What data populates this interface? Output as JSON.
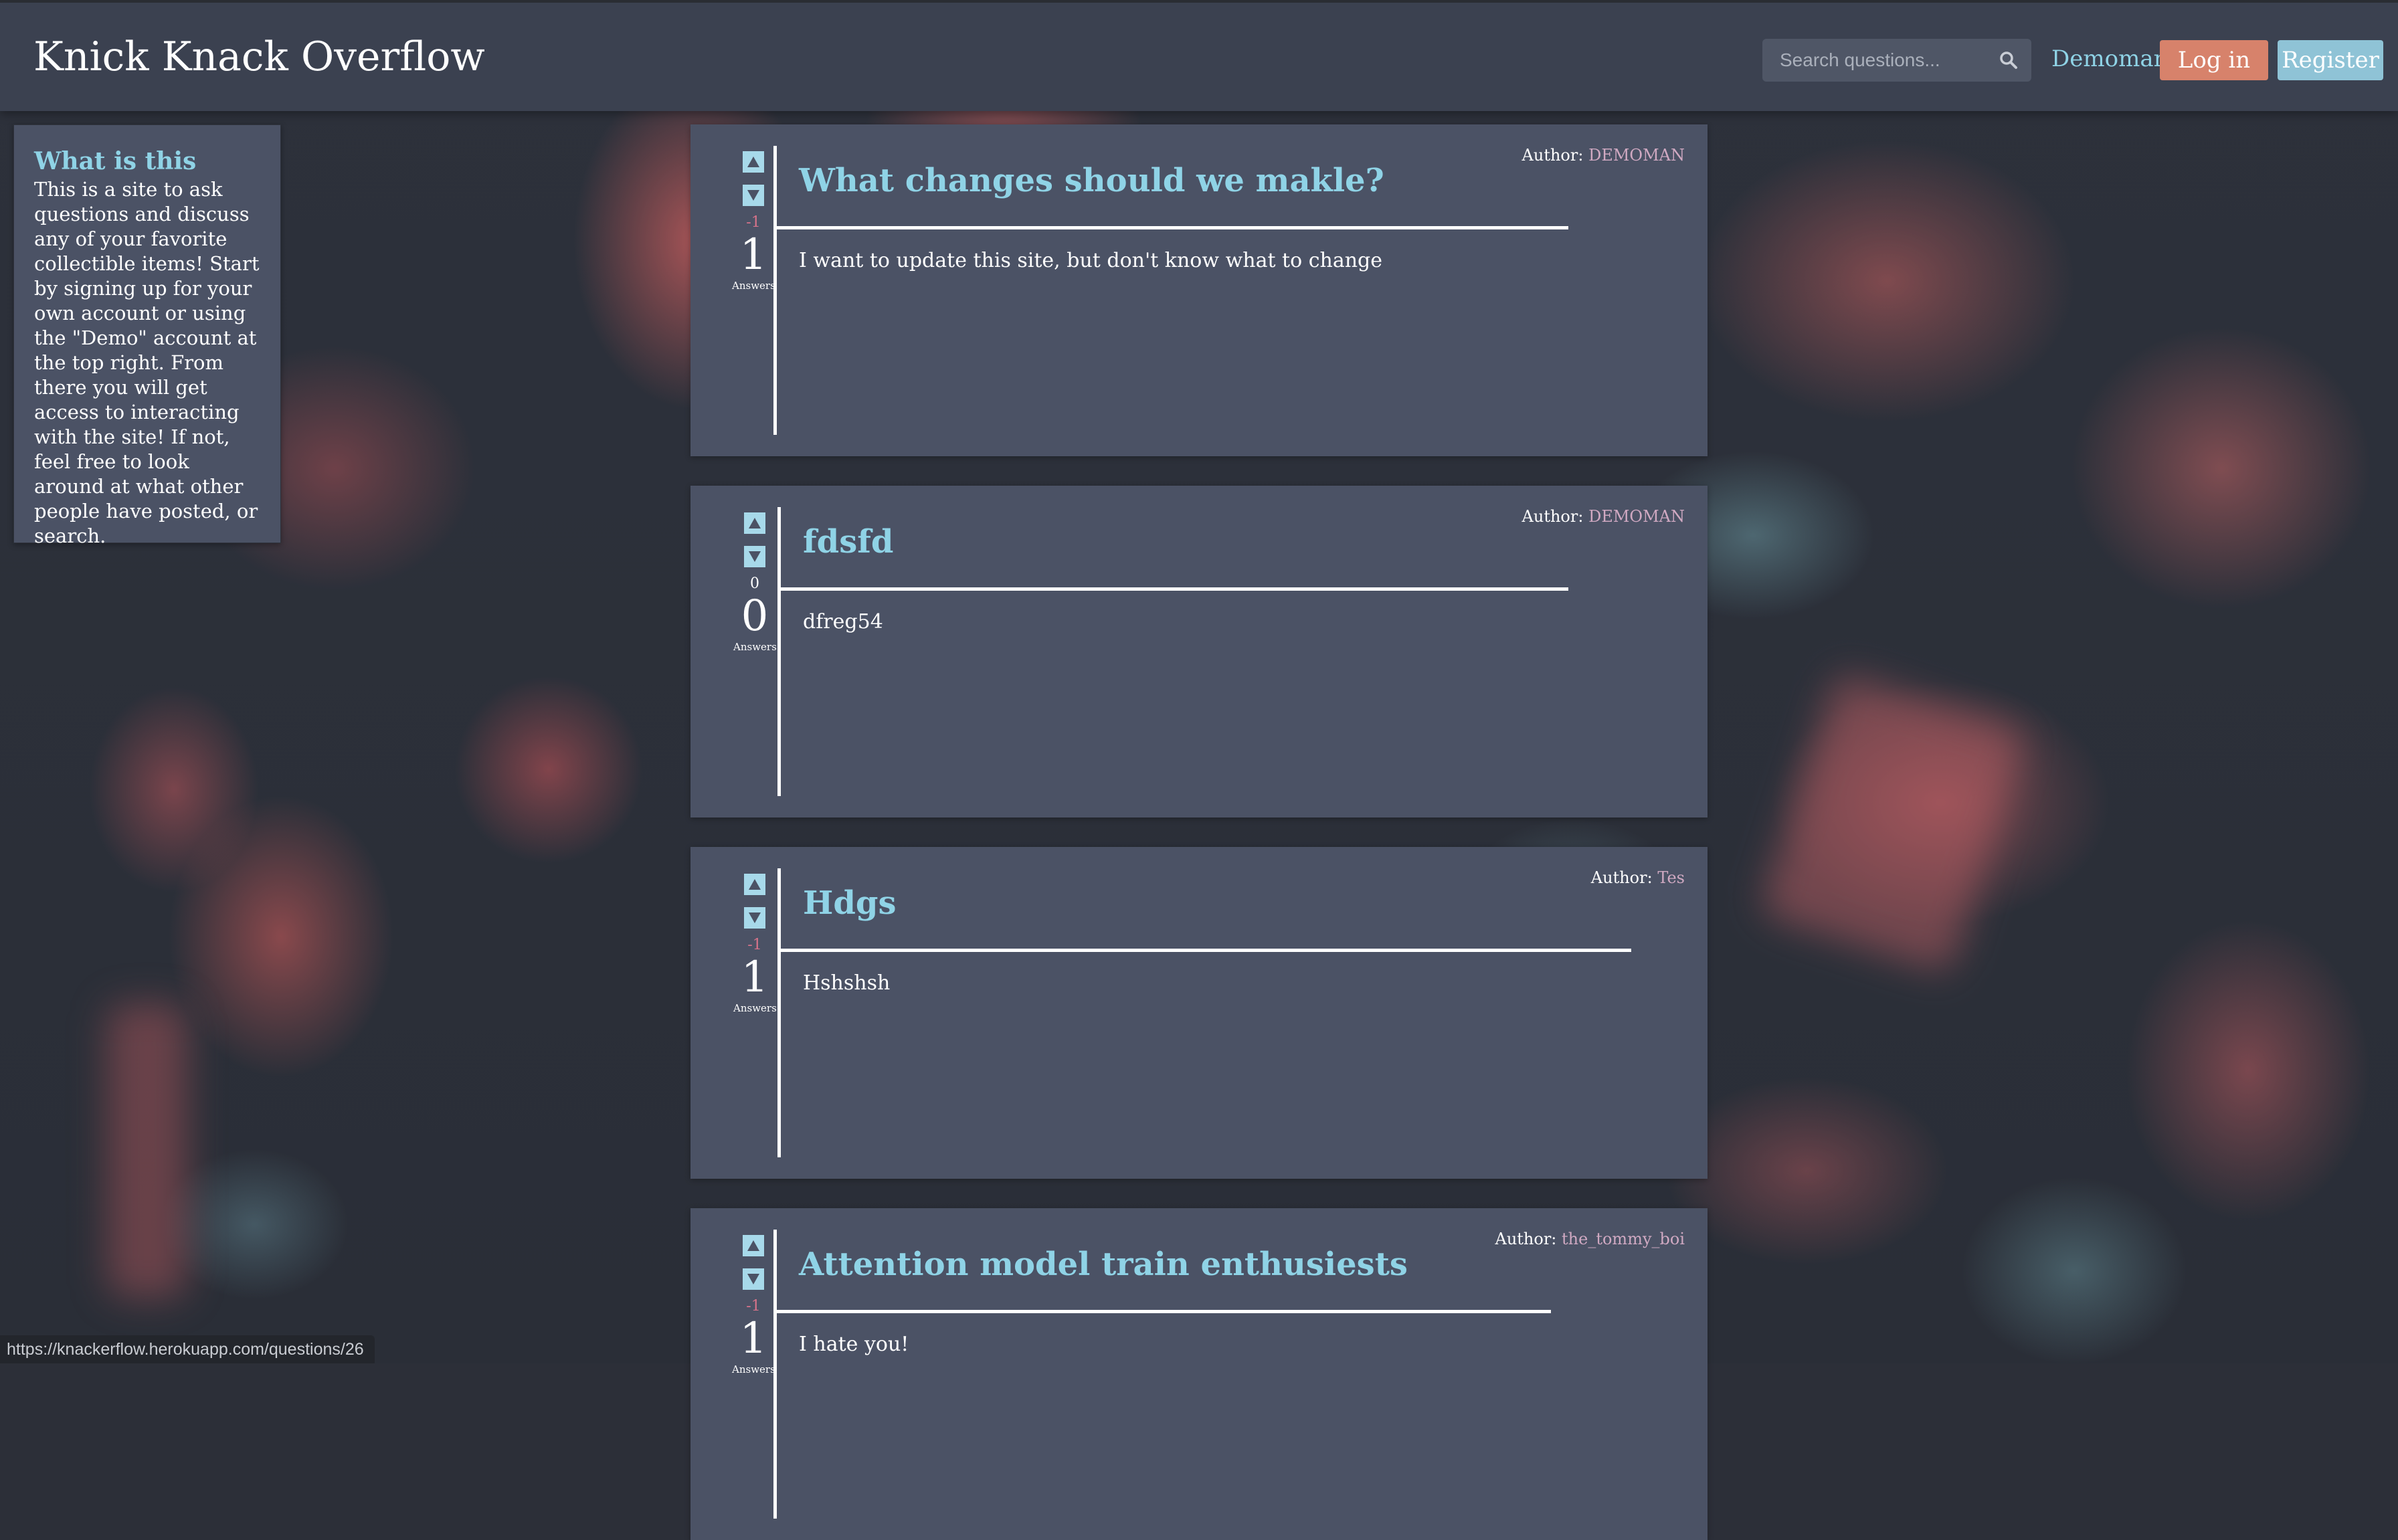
{
  "navbar": {
    "site_title": "Knick Knack Overflow",
    "search_placeholder": "Search questions...",
    "user_link": "Demoman",
    "login_label": "Log in",
    "register_label": "Register"
  },
  "info": {
    "title": "What is this",
    "body": "This is a site to ask questions and discuss any of your favorite collectible items! Start by signing up for your own account or using the \"Demo\" account at the top right. From there you will get access to interacting with the site! If not, feel free to look around at what other people have posted, or search."
  },
  "questions": [
    {
      "title": "What changes should we makle?",
      "body": "I want to update this site, but don't know what to change",
      "score": "-1",
      "answers": "1",
      "answers_label": "Answers",
      "author_label": "Author:",
      "author": "DEMOMAN"
    },
    {
      "title": "fdsfd",
      "body": "dfreg54",
      "score": "0",
      "answers": "0",
      "answers_label": "Answers",
      "author_label": "Author:",
      "author": "DEMOMAN"
    },
    {
      "title": "Hdgs",
      "body": "Hshshsh",
      "score": "-1",
      "answers": "1",
      "answers_label": "Answers",
      "author_label": "Author:",
      "author": "Tes"
    },
    {
      "title": "Attention model train enthusiests",
      "body": "I hate you!",
      "score": "-1",
      "answers": "1",
      "answers_label": "Answers",
      "author_label": "Author:",
      "author": "the_tommy_boi"
    }
  ],
  "status_bar": {
    "url": "https://knackerflow.herokuapp.com/questions/26"
  },
  "colors": {
    "accent": "#8fd3e6",
    "login": "#d7826b",
    "register": "#8fc3d6",
    "card": "#4b5265",
    "navbar": "#3b4150"
  },
  "icons": {
    "search": "search-icon",
    "upvote": "upvote-arrow-icon",
    "downvote": "downvote-arrow-icon"
  }
}
